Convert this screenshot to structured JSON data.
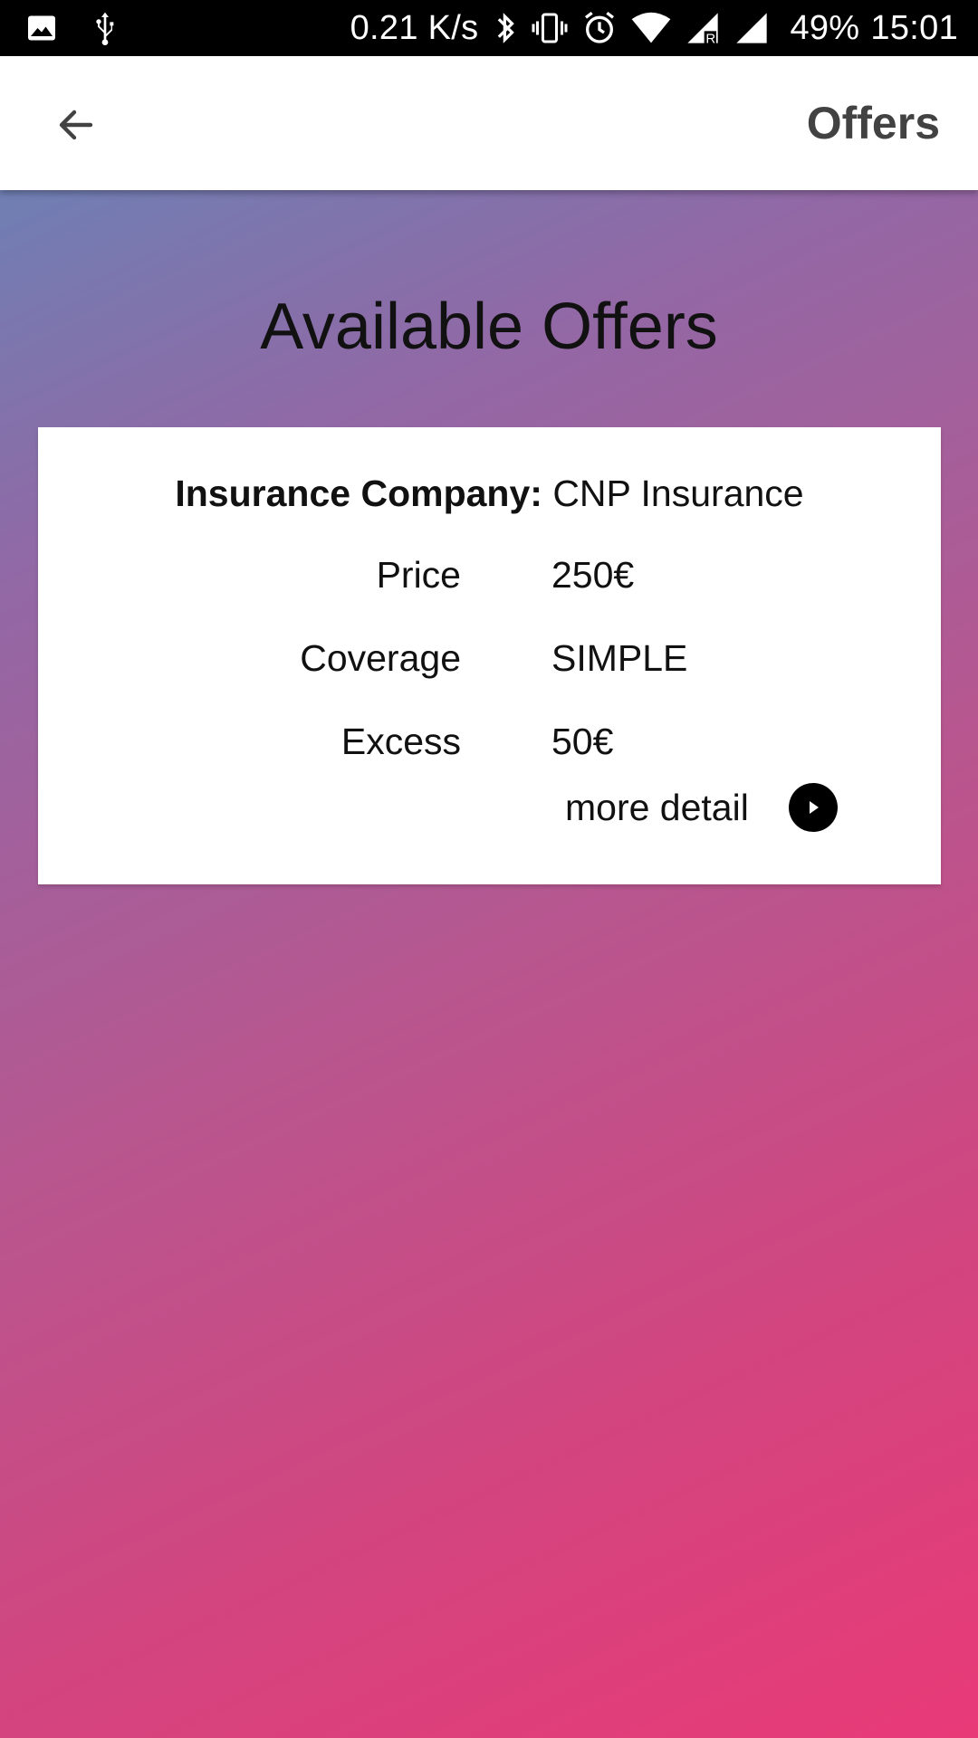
{
  "status_bar": {
    "speed": "0.21 K/s",
    "battery": "49%",
    "time": "15:01",
    "icons": [
      "image-icon",
      "usb-icon",
      "bluetooth-icon",
      "vibrate-icon",
      "alarm-icon",
      "wifi-icon",
      "signal-roaming-icon",
      "signal-icon"
    ]
  },
  "app_bar": {
    "title": "Offers",
    "back_icon": "arrow-back-icon"
  },
  "main": {
    "heading": "Available Offers",
    "offer": {
      "company_label": "Insurance Company:",
      "company_value": "CNP Insurance",
      "price_label": "Price",
      "price_value": "250€",
      "coverage_label": "Coverage",
      "coverage_value": "SIMPLE",
      "excess_label": "Excess",
      "excess_value": "50€",
      "more_detail_label": "more detail",
      "more_detail_icon": "play-circle-icon"
    }
  },
  "colors": {
    "gradient_start": "#6f7fb3",
    "gradient_end": "#e83a77",
    "card_background": "#ffffff",
    "title_text": "#424242"
  }
}
